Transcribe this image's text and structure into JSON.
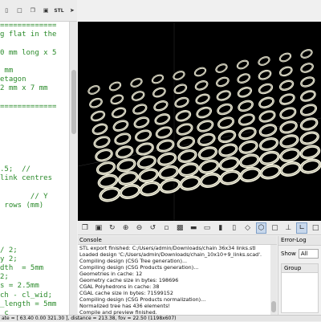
{
  "toolbar": {
    "buttons": [
      "new-file",
      "open-file",
      "save-file",
      "preview",
      "render",
      "export-stl",
      "send"
    ],
    "stl_label": "STL"
  },
  "editor": {
    "lines": [
      "=============",
      "g flat in the",
      "",
      "0 mm long x 5",
      "",
      " mm",
      "etagon",
      "2 mm x 7 mm",
      "",
      "=============",
      "",
      "",
      "",
      "",
      "",
      "",
      ".5;  //",
      "link centres",
      "",
      "       // Y",
      " rows (mm)",
      "",
      "",
      "",
      "",
      "/ 2;",
      "y 2;",
      "dth  = 5mm",
      "2;",
      "s = 2.5mm",
      "ch - cl_wid;",
      "_length = 5mm",
      "_c"
    ]
  },
  "console": {
    "title": "Console",
    "lines": [
      "STL export finished: C:/Users/admin/Downloads/chain 36x34 links.stl",
      "Loaded design 'C:/Users/admin/Downloads/chain_10x10+9_links.scad'.",
      "Compiling design (CSG Tree generation)...",
      "Compiling design (CSG Products generation)...",
      "Geometries in cache: 12",
      "Geometry cache size in bytes: 198696",
      "CGAL Polyhedrons in cache: 38",
      "CGAL cache size in bytes: 71599152",
      "Compiling design (CSG Products normalization)...",
      "Normalized tree has 436 elements!",
      "Compile and preview finished.",
      "Total rendering time: 0:00:01.838"
    ]
  },
  "errorlog": {
    "title": "Error-Log",
    "show_label": "Show",
    "show_value": "All",
    "column": "Group"
  },
  "status": {
    "text": "ate = [ 63.40 0.00 321.30 ], distance = 213.38, fov = 22.50 (1198x607)"
  },
  "colors": {
    "chain": "#f2f0dc",
    "viewport_bg": "#000000",
    "code_green": "#2a8a2a"
  }
}
